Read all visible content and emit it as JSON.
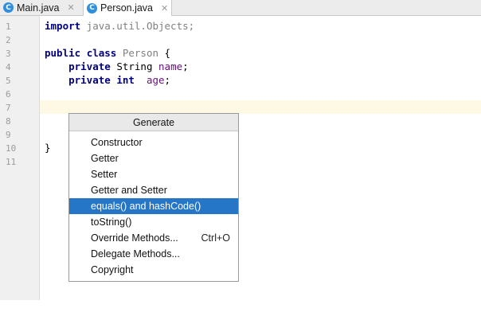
{
  "tabs": [
    {
      "icon": "C",
      "label": "Main.java",
      "close": "✕"
    },
    {
      "icon": "C",
      "label": "Person.java",
      "close": "✕"
    }
  ],
  "gutter": {
    "line_numbers": [
      "1",
      "2",
      "3",
      "4",
      "5",
      "6",
      "7",
      "8",
      "9",
      "10",
      "11"
    ]
  },
  "code": {
    "l1_kw": "import",
    "l1_rest": " java.util.Objects;",
    "l3_kw1": "public",
    "l3_kw2": "class",
    "l3_name": "Person",
    "l3_brace": " {",
    "l4_kw": "private",
    "l4_type": " String ",
    "l4_field": "name",
    "l4_end": ";",
    "l5_kw1": "private",
    "l5_kw2": "int",
    "l5_field": "age",
    "l5_end": ";",
    "l10": "}"
  },
  "generate_menu": {
    "title": "Generate",
    "items": [
      {
        "label": "Constructor",
        "shortcut": ""
      },
      {
        "label": "Getter",
        "shortcut": ""
      },
      {
        "label": "Setter",
        "shortcut": ""
      },
      {
        "label": "Getter and Setter",
        "shortcut": ""
      },
      {
        "label": "equals() and hashCode()",
        "shortcut": "",
        "selected": true
      },
      {
        "label": "toString()",
        "shortcut": ""
      },
      {
        "label": "Override Methods...",
        "shortcut": "Ctrl+O"
      },
      {
        "label": "Delegate Methods...",
        "shortcut": ""
      },
      {
        "label": "Copyright",
        "shortcut": ""
      }
    ]
  },
  "colors": {
    "selection": "#2676c7",
    "keyword": "#000080",
    "field": "#660e7a",
    "caret_line": "#fdf9e5"
  }
}
